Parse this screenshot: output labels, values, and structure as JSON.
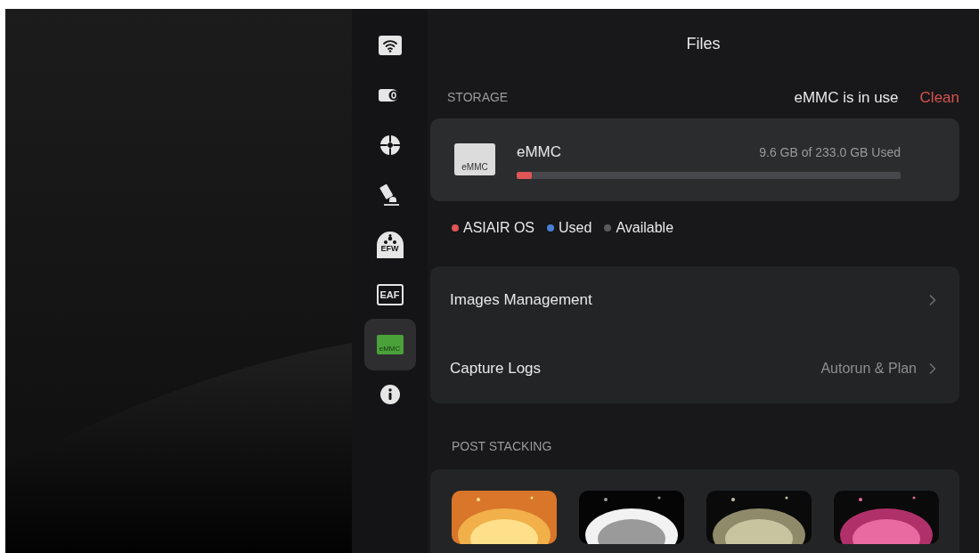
{
  "sidebar": {
    "items": [
      {
        "kind": "wifi",
        "selected": false
      },
      {
        "kind": "camera",
        "selected": false
      },
      {
        "kind": "guide",
        "selected": false
      },
      {
        "kind": "mount",
        "selected": false
      },
      {
        "kind": "efw",
        "label": "EFW",
        "selected": false
      },
      {
        "kind": "eaf",
        "label": "EAF",
        "selected": false
      },
      {
        "kind": "emmc",
        "label": "eMMC",
        "selected": true
      },
      {
        "kind": "info",
        "selected": false
      }
    ]
  },
  "title": "Files",
  "storage": {
    "heading": "STORAGE",
    "status": "eMMC is in use",
    "action": "Clean",
    "device": {
      "icon_label": "eMMC",
      "name": "eMMC",
      "usage": "9.6 GB of 233.0 GB Used",
      "segments": [
        {
          "color": "#e05555",
          "level": 0.04
        }
      ]
    },
    "legend": [
      {
        "label": "ASIAIR OS",
        "color": "#e05555"
      },
      {
        "label": "Used",
        "color": "#4a7fd6"
      },
      {
        "label": "Available",
        "color": "#5a5a5c"
      }
    ]
  },
  "menu": [
    {
      "label": "Images Management"
    },
    {
      "label": "Capture Logs",
      "value": "Autorun & Plan"
    }
  ],
  "post_stacking": {
    "heading": "POST STACKING"
  }
}
